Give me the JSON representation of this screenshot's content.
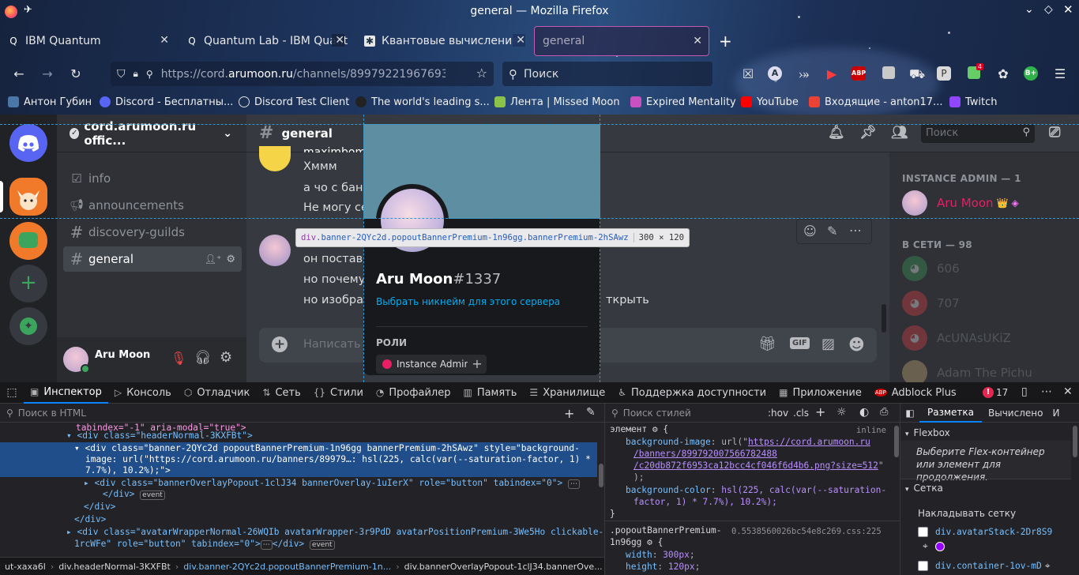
{
  "window": {
    "title": "general — Mozilla Firefox"
  },
  "tabs": [
    {
      "label": "IBM Quantum",
      "active": false
    },
    {
      "label": "Quantum Lab - IBM Quant",
      "active": false
    },
    {
      "label": "Квантовые вычисления",
      "active": false
    },
    {
      "label": "general",
      "active": true
    }
  ],
  "nav": {
    "url_prefix": "https://cord.",
    "url_domain": "arumoon.ru",
    "url_rest": "/channels/8997922196769301(",
    "search_placeholder": "Поиск"
  },
  "bookmarks": [
    {
      "label": "Антон Губин",
      "color": "#4a76a8"
    },
    {
      "label": "Discord - Бесплатны...",
      "color": "#5865f2"
    },
    {
      "label": "Discord Test Client",
      "color": "#9aa0a6"
    },
    {
      "label": "The world's leading s...",
      "color": "#222"
    },
    {
      "label": "Лента | Missed Moon",
      "color": "#8bc34a"
    },
    {
      "label": "Expired Mentality",
      "color": "#c850c0"
    },
    {
      "label": "YouTube",
      "color": "#ff0000"
    },
    {
      "label": "Входящие - anton17...",
      "color": "#ea4335"
    },
    {
      "label": "Twitch",
      "color": "#9146ff"
    }
  ],
  "toolbar_badges": {
    "abp": "ABP",
    "ext_count": "4"
  },
  "server": {
    "name": "cord.arumoon.ru offic..."
  },
  "channels": [
    {
      "name": "info",
      "kind": "rules"
    },
    {
      "name": "announcements",
      "kind": "announce"
    },
    {
      "name": "discovery-guilds",
      "kind": "text"
    },
    {
      "name": "general",
      "kind": "text",
      "selected": true
    }
  ],
  "user_panel": {
    "name": "Aru Moon"
  },
  "chat": {
    "channel": "general",
    "search_placeholder": "Поиск",
    "input_placeholder": "Написать @",
    "messages": [
      {
        "text": "Хммм"
      },
      {
        "text": "а чо с банн"
      },
      {
        "text": "Не могу се"
      },
      {
        "text": "он постави"
      },
      {
        "text": "но почему-"
      },
      {
        "text": "но изображ",
        "tail": "ткрыть"
      }
    ],
    "partial_author": "maximbom"
  },
  "members": {
    "admin_header": "INSTANCE ADMIN — 1",
    "admin": {
      "name": "Aru Moon",
      "crown": "👑"
    },
    "online_header": "В СЕТИ — 98",
    "online": [
      {
        "name": "606"
      },
      {
        "name": "707"
      },
      {
        "name": "AcUNAsUKiZ"
      },
      {
        "name": "Adam The Pichu"
      }
    ]
  },
  "popout": {
    "username": "Aru Moon",
    "discriminator": "#1337",
    "nick_link": "Выбрать никнейм для этого сервера",
    "roles_header": "РОЛИ",
    "role": "Instance Admin",
    "role_color": "#e91e63"
  },
  "tooltip": {
    "selector_tag": "div",
    "selector_rest": ".banner-2QYc2d.popoutBannerPremium-1n96gg.bannerPremium-2hSAwz",
    "size": "300 × 120"
  },
  "devtools": {
    "tabs": [
      "Инспектор",
      "Консоль",
      "Отладчик",
      "Сеть",
      "Стили",
      "Профайлер",
      "Память",
      "Хранилище",
      "Поддержка доступности",
      "Приложение",
      "Adblock Plus"
    ],
    "error_count": "17",
    "html_search_placeholder": "Поиск в HTML",
    "styles_search_placeholder": "Поиск стилей",
    "hov": ":hov",
    "cls": ".cls",
    "layout_tabs": [
      "Разметка",
      "Вычислено",
      "И"
    ],
    "flexbox_header": "Flexbox",
    "flexbox_hint": "Выберите Flex-контейнер или элемент для продолжения.",
    "grid_header": "Сетка",
    "grid_overlay": "Накладывать сетку",
    "grid_items": [
      "div.avatarStack-2Dr8S9",
      "div.container-1ov-mD"
    ],
    "html_lines": [
      "tabindex=\"-1\" aria-modal=\"true\">",
      "<div class=\"headerNormal-3KXFBt\">",
      "<div class=\"banner-2QYc2d popoutBannerPremium-1n96gg bannerPremium-2hSAwz\" style=\"background-",
      "image: url(\"https://cord.arumoon.ru/banners/89979…: hsl(225, calc(var(--saturation-factor, 1) *",
      "7.7%), 10.2%);\">",
      "<div class=\"bannerOverlayPopout-1clJ34 bannerOverlay-1uIerX\" role=\"button\" tabindex=\"0\">",
      "</div>",
      "</div>",
      "</div>",
      "<div class=\"avatarWrapperNormal-26WQIb avatarWrapper-3r9PdD avatarPositionPremium-3We5Ho clickable-",
      "1rcWFe\" role=\"button\" tabindex=\"0\">",
      "</div>"
    ],
    "css_rules": {
      "element_selector": "элемент",
      "inline": "inline",
      "bg_image_prop": "background-image",
      "bg_image_val_1": "https://cord.arumoon.ru",
      "bg_image_val_2": "/banners/899792007566782488",
      "bg_image_val_3": "/c20db872f6953ca12bcc4cf046f6d4b6.png?size=512",
      "bg_color_prop": "background-color",
      "bg_color_val": "hsl(225, calc(var(--saturation-",
      "bg_color_val_2": "factor, 1) * 7.7%), 10.2%);",
      "rule2_selector": ".popoutBannerPremium-",
      "rule2_selector_2": "1n96gg",
      "rule2_source": "0.5538560026bc54e8c269.css:225",
      "width_prop": "width",
      "width_val": "300px",
      "height_prop": "height",
      "height_val": "120px"
    },
    "breadcrumbs": [
      "ut-xaxa6l",
      "div.headerNormal-3KXFBt",
      "div.banner-2QYc2d.popoutBannerPremium-1n...",
      "div.bannerOverlayPopout-1clJ34.bannerOve..."
    ]
  }
}
